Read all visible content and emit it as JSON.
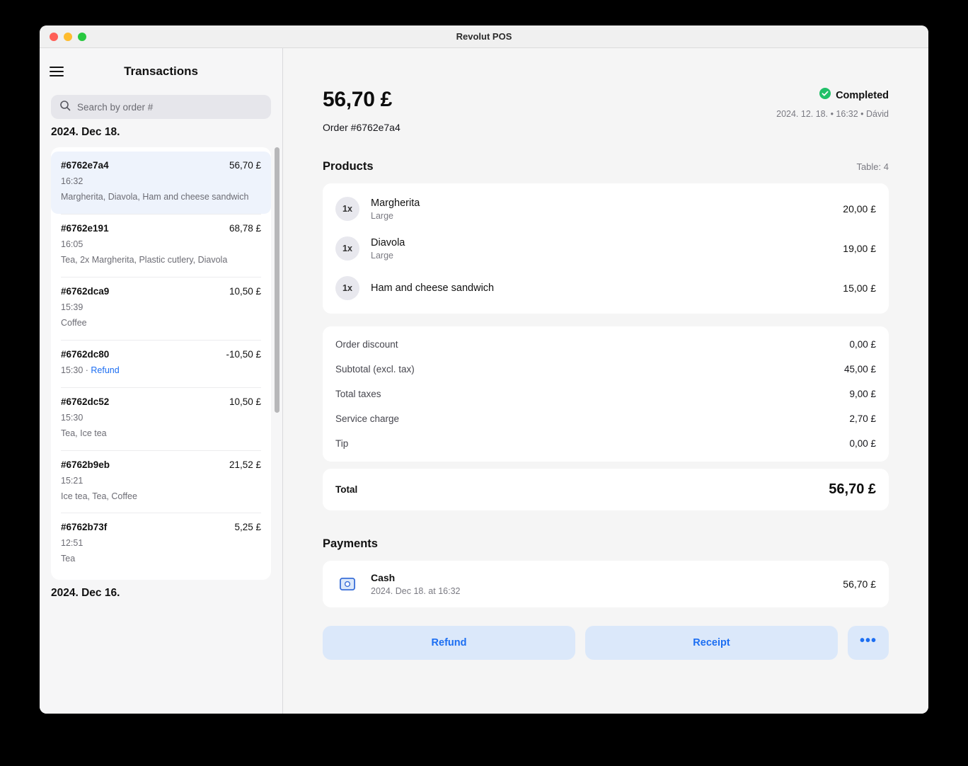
{
  "window": {
    "title": "Revolut POS",
    "traffic_lights": [
      "close",
      "minimize",
      "zoom"
    ]
  },
  "sidebar": {
    "menu_icon": "hamburger-icon",
    "title": "Transactions",
    "search": {
      "icon": "search-icon",
      "placeholder": "Search by order #",
      "value": ""
    },
    "groups": [
      {
        "date": "2024. Dec 18.",
        "transactions": [
          {
            "id": "#6762e7a4",
            "amount": "56,70 £",
            "time": "16:32",
            "tag": "",
            "items": "Margherita, Diavola, Ham and cheese sandwich",
            "selected": true
          },
          {
            "id": "#6762e191",
            "amount": "68,78 £",
            "time": "16:05",
            "tag": "",
            "items": "Tea, 2x Margherita, Plastic cutlery, Diavola",
            "selected": false
          },
          {
            "id": "#6762dca9",
            "amount": "10,50 £",
            "time": "15:39",
            "tag": "",
            "items": "Coffee",
            "selected": false
          },
          {
            "id": "#6762dc80",
            "amount": "-10,50 £",
            "time": "15:30",
            "tag": "Refund",
            "items": "",
            "selected": false
          },
          {
            "id": "#6762dc52",
            "amount": "10,50 £",
            "time": "15:30",
            "tag": "",
            "items": "Tea, Ice tea",
            "selected": false
          },
          {
            "id": "#6762b9eb",
            "amount": "21,52 £",
            "time": "15:21",
            "tag": "",
            "items": "Ice tea, Tea, Coffee",
            "selected": false
          },
          {
            "id": "#6762b73f",
            "amount": "5,25 £",
            "time": "12:51",
            "tag": "",
            "items": "Tea",
            "selected": false
          }
        ]
      },
      {
        "date": "2024. Dec 16.",
        "transactions": []
      }
    ]
  },
  "detail": {
    "amount": "56,70 £",
    "order_label": "Order #6762e7a4",
    "status": {
      "icon": "check-circle-icon",
      "label": "Completed",
      "color": "#20c068"
    },
    "meta": "2024. 12. 18. • 16:32 • Dávid",
    "products_section": {
      "title": "Products",
      "side_label": "Table: 4",
      "items": [
        {
          "qty": "1x",
          "name": "Margherita",
          "variant": "Large",
          "price": "20,00 £"
        },
        {
          "qty": "1x",
          "name": "Diavola",
          "variant": "Large",
          "price": "19,00 £"
        },
        {
          "qty": "1x",
          "name": "Ham and cheese sandwich",
          "variant": "",
          "price": "15,00 £"
        }
      ]
    },
    "totals": [
      {
        "label": "Order discount",
        "value": "0,00 £"
      },
      {
        "label": "Subtotal (excl. tax)",
        "value": "45,00 £"
      },
      {
        "label": "Total taxes",
        "value": "9,00 £"
      },
      {
        "label": "Service charge",
        "value": "2,70 £"
      },
      {
        "label": "Tip",
        "value": "0,00 £"
      }
    ],
    "grand_total": {
      "label": "Total",
      "value": "56,70 £"
    },
    "payments_section": {
      "title": "Payments",
      "items": [
        {
          "icon": "cash-icon",
          "name": "Cash",
          "date": "2024. Dec 18. at 16:32",
          "amount": "56,70 £"
        }
      ]
    },
    "actions": {
      "refund_label": "Refund",
      "receipt_label": "Receipt",
      "more_label": "•••",
      "accent_color": "#1c6ef2",
      "button_bg": "#dbe8fa"
    }
  }
}
